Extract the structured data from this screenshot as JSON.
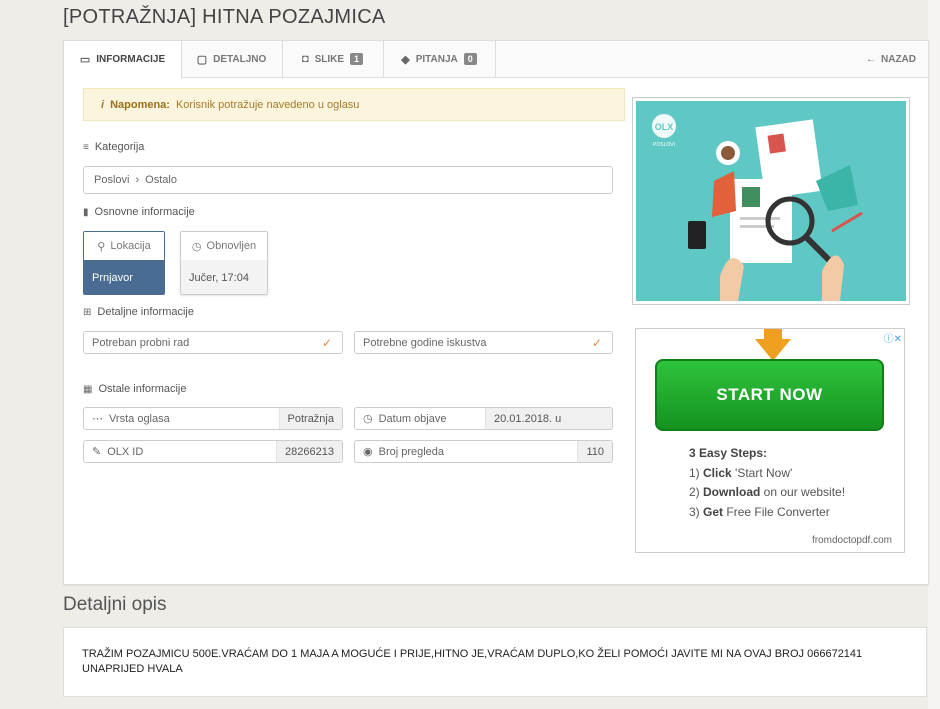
{
  "page_title": "[POTRAŽNJA] HITNA POZAJMICA",
  "tabs": [
    {
      "label": "INFORMACIJE",
      "icon": "card-icon"
    },
    {
      "label": "DETALJNO",
      "icon": "doc-icon"
    },
    {
      "label": "SLIKE",
      "icon": "camera-icon",
      "count": "1"
    },
    {
      "label": "PITANJA",
      "icon": "chat-icon",
      "count": "0"
    }
  ],
  "back_label": "NAZAD",
  "note": {
    "bold": "Napomena:",
    "text": "Korisnik potražuje navedeno u oglasu"
  },
  "category": {
    "heading": "Kategorija",
    "path": [
      "Poslovi",
      "Ostalo"
    ],
    "separator": "›"
  },
  "basic": {
    "heading": "Osnovne informacije",
    "location_label": "Lokacija",
    "location_value": "Prnjavor",
    "updated_label": "Obnovljen",
    "updated_value": "Jučer, 17:04"
  },
  "detailed": {
    "heading": "Detaljne informacije",
    "items": [
      "Potreban probni rad",
      "Potrebne godine iskustva"
    ]
  },
  "other": {
    "heading": "Ostale informacije",
    "items": [
      {
        "label": "Vrsta oglasa",
        "value": "Potražnja",
        "icon": "dots-icon"
      },
      {
        "label": "Datum objave",
        "value": "20.01.2018. u",
        "icon": "clock-icon"
      },
      {
        "label": "OLX ID",
        "value": "28266213",
        "icon": "wrench-icon"
      },
      {
        "label": "Broj pregleda",
        "value": "110",
        "icon": "eye-icon"
      }
    ]
  },
  "ad": {
    "button": "START NOW",
    "steps_title": "3 Easy Steps:",
    "steps": [
      {
        "n": "1)",
        "bold": "Click",
        "rest": " 'Start Now'"
      },
      {
        "n": "2)",
        "bold": "Download",
        "rest": " on our website!"
      },
      {
        "n": "3)",
        "bold": "Get",
        "rest": " Free File Converter"
      }
    ],
    "source": "fromdoctopdf.com"
  },
  "hero": {
    "logo_text": "OLX",
    "logo_sub": "POSLOVI"
  },
  "description": {
    "heading": "Detaljni opis",
    "text": "TRAŽIM POZAJMICU 500E.VRAĆAM DO 1 MAJA A MOGUĆE I PRIJE,HITNO JE,VRAĆAM DUPLO,KO ŽELI POMOĆI JAVITE MI NA OVAJ BROJ 066672141 UNAPRIJED HVALA"
  },
  "colors": {
    "accent_blue": "#4a6c92",
    "check_orange": "#e08a3c",
    "note_bg": "#fcf5dd",
    "hero_bg": "#5fc7c4"
  }
}
